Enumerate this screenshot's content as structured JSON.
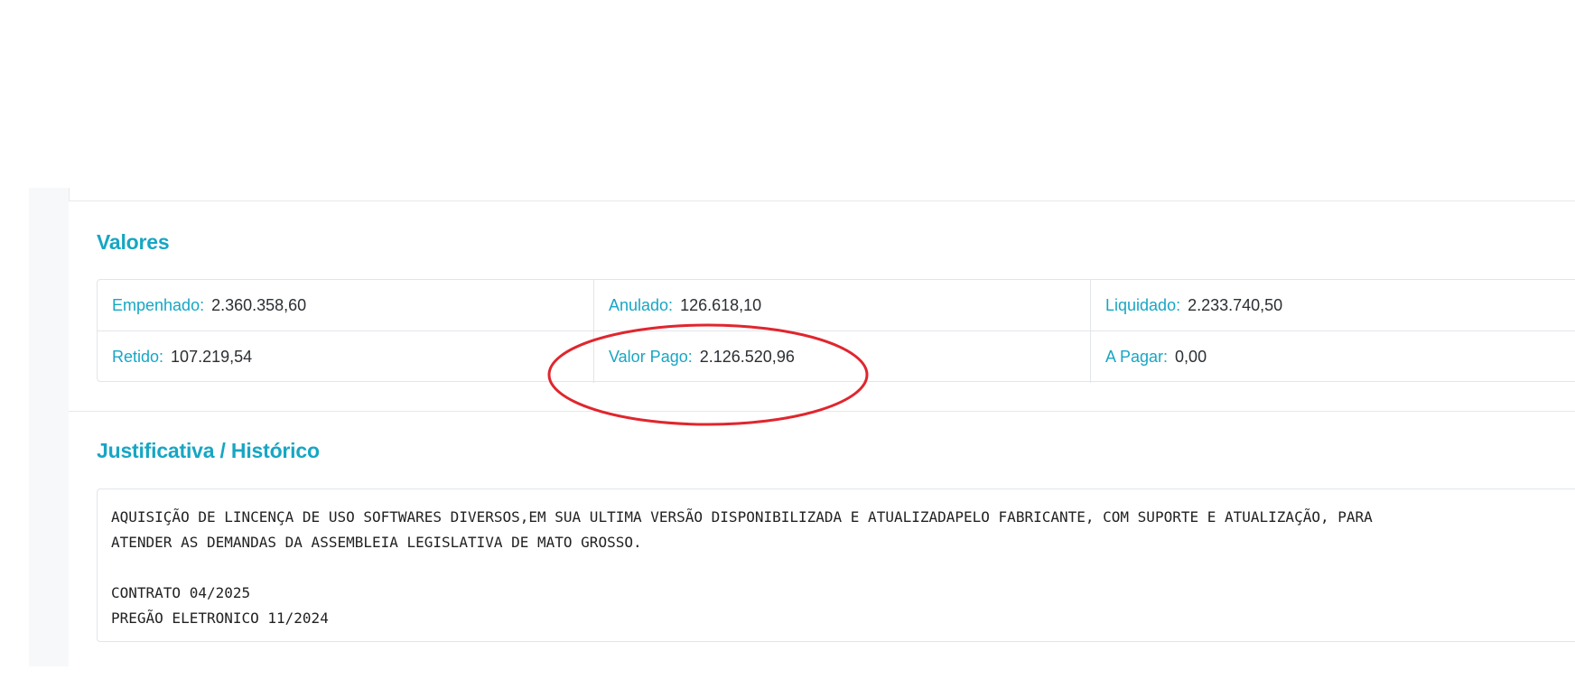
{
  "valores": {
    "title": "Valores",
    "rows": [
      [
        {
          "label": "Empenhado:",
          "value": "2.360.358,60"
        },
        {
          "label": "Anulado:",
          "value": "126.618,10"
        },
        {
          "label": "Liquidado:",
          "value": "2.233.740,50"
        }
      ],
      [
        {
          "label": "Retido:",
          "value": "107.219,54"
        },
        {
          "label": "Valor Pago:",
          "value": "2.126.520,96"
        },
        {
          "label": "A Pagar:",
          "value": "0,00"
        }
      ]
    ]
  },
  "justificativa": {
    "title": "Justificativa / Histórico",
    "lines": [
      "AQUISIÇÃO DE LINCENÇA DE USO SOFTWARES DIVERSOS,EM SUA ULTIMA VERSÃO DISPONIBILIZADA E ATUALIZADAPELO FABRICANTE, COM SUPORTE E ATUALIZAÇÃO, PARA",
      "ATENDER AS DEMANDAS DA ASSEMBLEIA LEGISLATIVA DE MATO GROSSO.",
      "",
      "CONTRATO 04/2025",
      "PREGÃO ELETRONICO 11/2024"
    ]
  },
  "colors": {
    "accent": "#17a6c4",
    "annotation": "#e0262e"
  }
}
